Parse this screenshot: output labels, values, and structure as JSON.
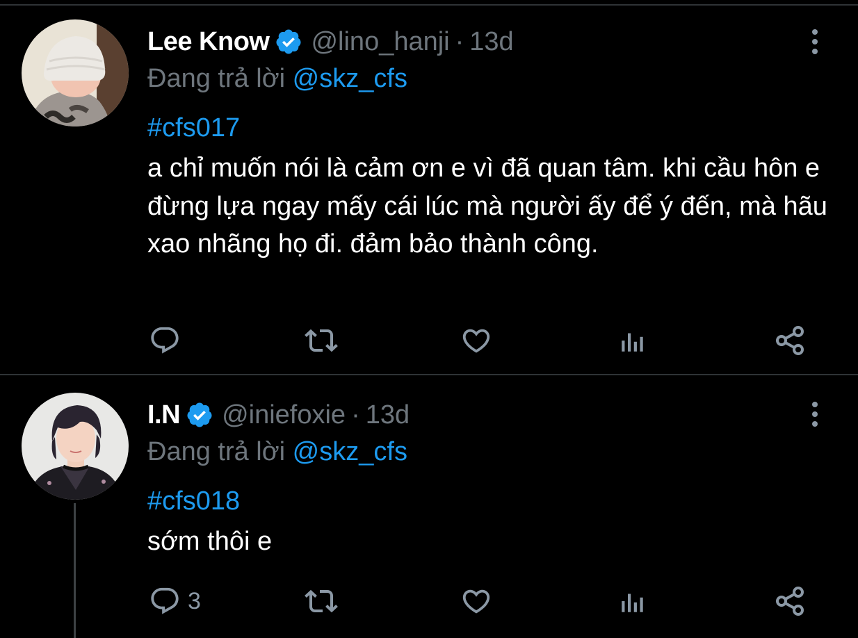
{
  "colors": {
    "background": "#000000",
    "text": "#ffffff",
    "muted": "#6e767d",
    "accent": "#1d9bf0",
    "divider": "#2f3336",
    "icon": "#8b98a5"
  },
  "tweets": [
    {
      "name": "Lee Know",
      "verified": true,
      "handle": "@lino_hanji",
      "separator": "·",
      "time": "13d",
      "reply_prefix": "Đang trả lời",
      "reply_to": "@skz_cfs",
      "hashtag": "#cfs017",
      "text": "a chỉ muốn nói là cảm ơn e vì đã quan tâm. khi cầu hôn e đừng lựa ngay mấy cái lúc mà người ấy để ý đến, mà hãu xao nhãng họ đi. đảm bảo thành công.",
      "actions": {
        "reply_count": "",
        "retweet_count": "",
        "like_count": ""
      },
      "icons": [
        "reply-icon",
        "retweet-icon",
        "like-icon",
        "analytics-icon",
        "share-icon",
        "more-icon"
      ]
    },
    {
      "name": "I.N",
      "verified": true,
      "handle": "@iniefoxie",
      "separator": "·",
      "time": "13d",
      "reply_prefix": "Đang trả lời",
      "reply_to": "@skz_cfs",
      "hashtag": "#cfs018",
      "text": "sớm thôi e",
      "actions": {
        "reply_count": "3",
        "retweet_count": "",
        "like_count": ""
      },
      "icons": [
        "reply-icon",
        "retweet-icon",
        "like-icon",
        "analytics-icon",
        "share-icon",
        "more-icon"
      ]
    }
  ]
}
